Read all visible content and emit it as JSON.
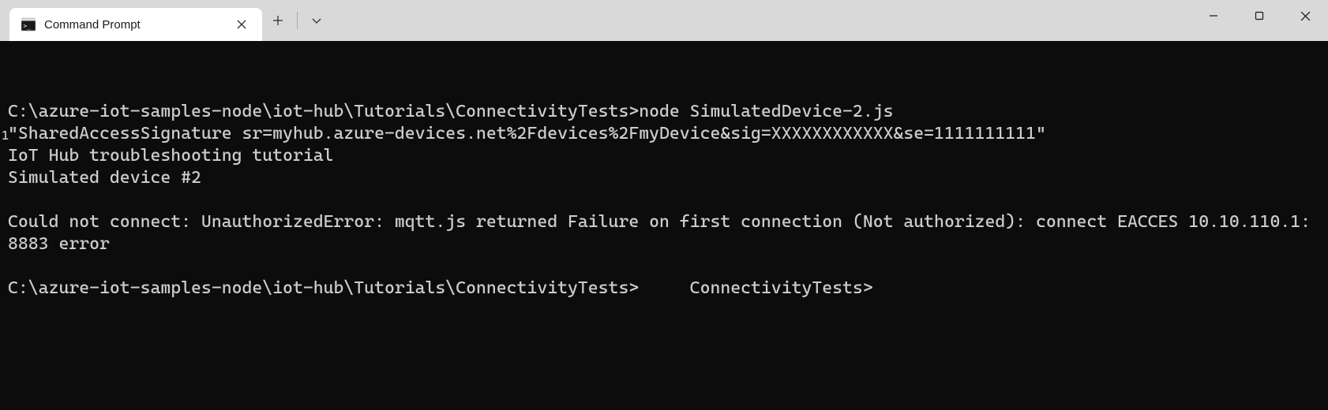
{
  "tab": {
    "title": "Command Prompt"
  },
  "overlay": "1",
  "terminal": {
    "lines": [
      "C:\\azure-iot-samples-node\\iot-hub\\Tutorials\\ConnectivityTests>node SimulatedDevice-2.js",
      "\"SharedAccessSignature sr=myhub.azure-devices.net%2Fdevices%2FmyDevice&sig=XXXXXXXXXXXX&se=1111111111\"",
      "IoT Hub troubleshooting tutorial",
      "Simulated device #2",
      "",
      "Could not connect: UnauthorizedError: mqtt.js returned Failure on first connection (Not authorized): connect EACCES 10.10.110.1:8883 error",
      "",
      "C:\\azure-iot-samples-node\\iot-hub\\Tutorials\\ConnectivityTests>     ConnectivityTests>"
    ]
  }
}
